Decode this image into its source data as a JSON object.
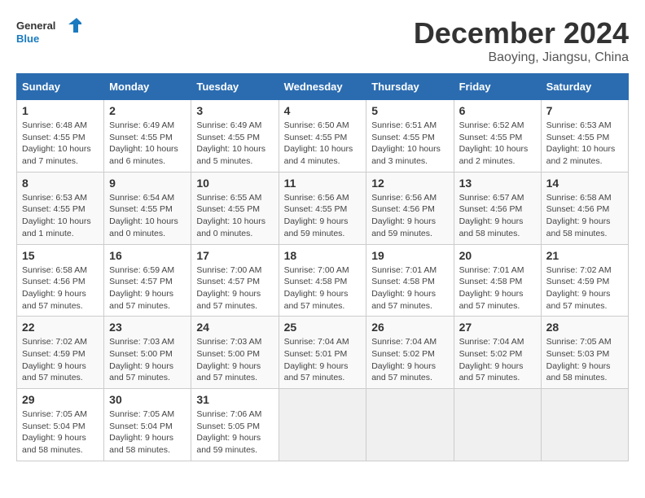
{
  "header": {
    "logo_general": "General",
    "logo_blue": "Blue",
    "title": "December 2024",
    "location": "Baoying, Jiangsu, China"
  },
  "days_of_week": [
    "Sunday",
    "Monday",
    "Tuesday",
    "Wednesday",
    "Thursday",
    "Friday",
    "Saturday"
  ],
  "weeks": [
    [
      {
        "day": "1",
        "info": "Sunrise: 6:48 AM\nSunset: 4:55 PM\nDaylight: 10 hours\nand 7 minutes."
      },
      {
        "day": "2",
        "info": "Sunrise: 6:49 AM\nSunset: 4:55 PM\nDaylight: 10 hours\nand 6 minutes."
      },
      {
        "day": "3",
        "info": "Sunrise: 6:49 AM\nSunset: 4:55 PM\nDaylight: 10 hours\nand 5 minutes."
      },
      {
        "day": "4",
        "info": "Sunrise: 6:50 AM\nSunset: 4:55 PM\nDaylight: 10 hours\nand 4 minutes."
      },
      {
        "day": "5",
        "info": "Sunrise: 6:51 AM\nSunset: 4:55 PM\nDaylight: 10 hours\nand 3 minutes."
      },
      {
        "day": "6",
        "info": "Sunrise: 6:52 AM\nSunset: 4:55 PM\nDaylight: 10 hours\nand 2 minutes."
      },
      {
        "day": "7",
        "info": "Sunrise: 6:53 AM\nSunset: 4:55 PM\nDaylight: 10 hours\nand 2 minutes."
      }
    ],
    [
      {
        "day": "8",
        "info": "Sunrise: 6:53 AM\nSunset: 4:55 PM\nDaylight: 10 hours\nand 1 minute."
      },
      {
        "day": "9",
        "info": "Sunrise: 6:54 AM\nSunset: 4:55 PM\nDaylight: 10 hours\nand 0 minutes."
      },
      {
        "day": "10",
        "info": "Sunrise: 6:55 AM\nSunset: 4:55 PM\nDaylight: 10 hours\nand 0 minutes."
      },
      {
        "day": "11",
        "info": "Sunrise: 6:56 AM\nSunset: 4:55 PM\nDaylight: 9 hours\nand 59 minutes."
      },
      {
        "day": "12",
        "info": "Sunrise: 6:56 AM\nSunset: 4:56 PM\nDaylight: 9 hours\nand 59 minutes."
      },
      {
        "day": "13",
        "info": "Sunrise: 6:57 AM\nSunset: 4:56 PM\nDaylight: 9 hours\nand 58 minutes."
      },
      {
        "day": "14",
        "info": "Sunrise: 6:58 AM\nSunset: 4:56 PM\nDaylight: 9 hours\nand 58 minutes."
      }
    ],
    [
      {
        "day": "15",
        "info": "Sunrise: 6:58 AM\nSunset: 4:56 PM\nDaylight: 9 hours\nand 57 minutes."
      },
      {
        "day": "16",
        "info": "Sunrise: 6:59 AM\nSunset: 4:57 PM\nDaylight: 9 hours\nand 57 minutes."
      },
      {
        "day": "17",
        "info": "Sunrise: 7:00 AM\nSunset: 4:57 PM\nDaylight: 9 hours\nand 57 minutes."
      },
      {
        "day": "18",
        "info": "Sunrise: 7:00 AM\nSunset: 4:58 PM\nDaylight: 9 hours\nand 57 minutes."
      },
      {
        "day": "19",
        "info": "Sunrise: 7:01 AM\nSunset: 4:58 PM\nDaylight: 9 hours\nand 57 minutes."
      },
      {
        "day": "20",
        "info": "Sunrise: 7:01 AM\nSunset: 4:58 PM\nDaylight: 9 hours\nand 57 minutes."
      },
      {
        "day": "21",
        "info": "Sunrise: 7:02 AM\nSunset: 4:59 PM\nDaylight: 9 hours\nand 57 minutes."
      }
    ],
    [
      {
        "day": "22",
        "info": "Sunrise: 7:02 AM\nSunset: 4:59 PM\nDaylight: 9 hours\nand 57 minutes."
      },
      {
        "day": "23",
        "info": "Sunrise: 7:03 AM\nSunset: 5:00 PM\nDaylight: 9 hours\nand 57 minutes."
      },
      {
        "day": "24",
        "info": "Sunrise: 7:03 AM\nSunset: 5:00 PM\nDaylight: 9 hours\nand 57 minutes."
      },
      {
        "day": "25",
        "info": "Sunrise: 7:04 AM\nSunset: 5:01 PM\nDaylight: 9 hours\nand 57 minutes."
      },
      {
        "day": "26",
        "info": "Sunrise: 7:04 AM\nSunset: 5:02 PM\nDaylight: 9 hours\nand 57 minutes."
      },
      {
        "day": "27",
        "info": "Sunrise: 7:04 AM\nSunset: 5:02 PM\nDaylight: 9 hours\nand 57 minutes."
      },
      {
        "day": "28",
        "info": "Sunrise: 7:05 AM\nSunset: 5:03 PM\nDaylight: 9 hours\nand 58 minutes."
      }
    ],
    [
      {
        "day": "29",
        "info": "Sunrise: 7:05 AM\nSunset: 5:04 PM\nDaylight: 9 hours\nand 58 minutes."
      },
      {
        "day": "30",
        "info": "Sunrise: 7:05 AM\nSunset: 5:04 PM\nDaylight: 9 hours\nand 58 minutes."
      },
      {
        "day": "31",
        "info": "Sunrise: 7:06 AM\nSunset: 5:05 PM\nDaylight: 9 hours\nand 59 minutes."
      },
      null,
      null,
      null,
      null
    ]
  ]
}
